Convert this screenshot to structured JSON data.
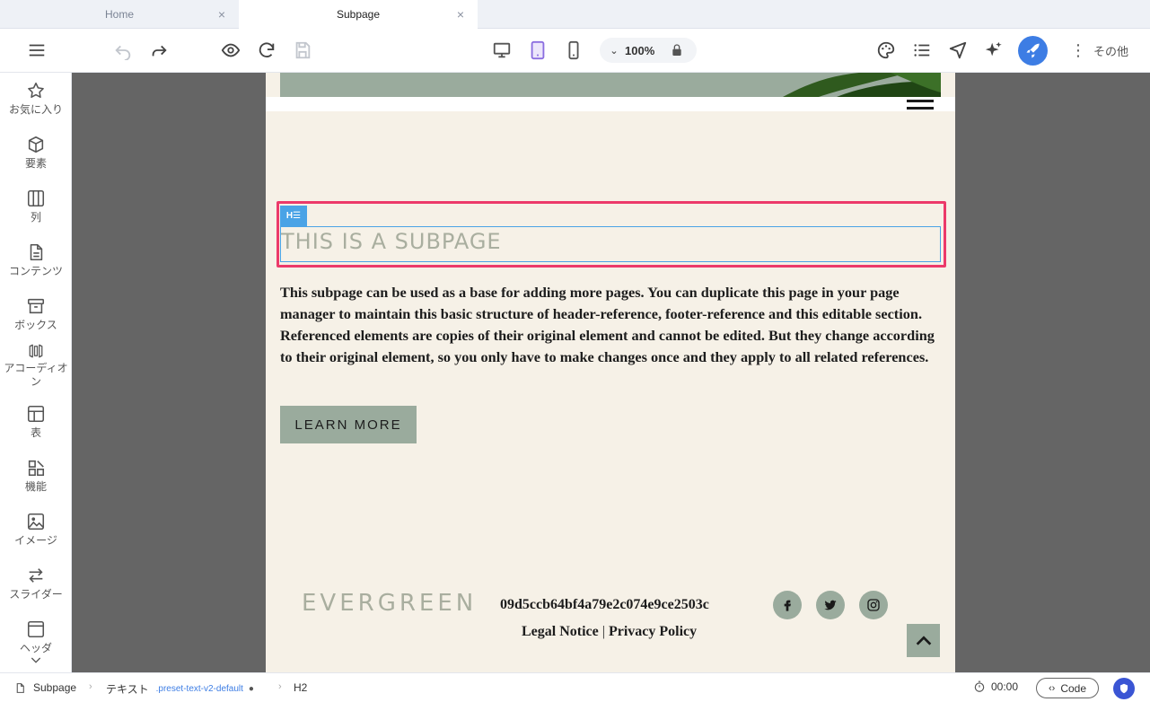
{
  "tabs": [
    {
      "label": "Home",
      "active": false
    },
    {
      "label": "Subpage",
      "active": true
    }
  ],
  "toolbar": {
    "zoom": "100%",
    "more_label": "その他",
    "accent": "#3d7de4"
  },
  "sidebar": {
    "items": [
      {
        "label": "お気に入り",
        "icon": "star-icon"
      },
      {
        "label": "要素",
        "icon": "cube-icon"
      },
      {
        "label": "列",
        "icon": "columns-icon"
      },
      {
        "label": "コンテンツ",
        "icon": "document-icon"
      },
      {
        "label": "ボックス",
        "icon": "box-icon"
      },
      {
        "label": "アコーディオン",
        "icon": "accordion-icon"
      },
      {
        "label": "表",
        "icon": "table-icon"
      },
      {
        "label": "機能",
        "icon": "features-icon"
      },
      {
        "label": "イメージ",
        "icon": "image-icon"
      },
      {
        "label": "スライダー",
        "icon": "slider-icon"
      },
      {
        "label": "ヘッダ",
        "icon": "header-icon"
      }
    ]
  },
  "page": {
    "heading": "THIS IS A SUBPAGE",
    "element_tag": "H☰",
    "paragraph": "This subpage can be used as a base for adding more pages. You can duplicate this page in your page manager to maintain this basic structure of header-reference, footer-reference and this editable section. Referenced elements are copies of their original element and cannot be edited. But they change according to their original element, so you only have to make changes once and they apply to all related references.",
    "button": "LEARN MORE",
    "footer": {
      "logo": "EVERGREEN",
      "hash": "09d5ccb64bf4a79e2c074e9ce2503c",
      "legal": "Legal Notice",
      "separator": "|",
      "privacy": "Privacy Policy"
    },
    "colors": {
      "background": "#f6f1e7",
      "sage": "#9aab9d",
      "selection": "#ec3a6a"
    }
  },
  "statusbar": {
    "page": "Subpage",
    "element": "テキスト",
    "preset": ".preset-text-v2-default",
    "tag": "H2",
    "timer": "00:00",
    "code": "Code"
  }
}
